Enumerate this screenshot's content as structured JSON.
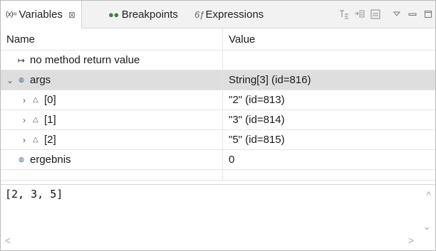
{
  "tabs": [
    {
      "icon_text": "(x)=",
      "label": "Variables",
      "close": "⊠"
    },
    {
      "icon_text": "●●",
      "label": "Breakpoints"
    },
    {
      "icon_text": "6ƒ",
      "label": "Expressions"
    }
  ],
  "toolbar": {
    "icons": [
      "show-type-names-icon",
      "collapse-all-icon",
      "layout-icon",
      "view-menu-icon",
      "minimize-icon",
      "maximize-icon"
    ]
  },
  "table": {
    "headers": {
      "name": "Name",
      "value": "Value"
    },
    "rows": [
      {
        "expander": "",
        "icon": "↦",
        "name": "no method return value",
        "value": ""
      },
      {
        "expander": "⌄",
        "icon": "◍",
        "name": "args",
        "value": "String[3]  (id=816)"
      },
      {
        "expander": "›",
        "icon": "△",
        "name": "[0]",
        "value": "\"2\" (id=813)"
      },
      {
        "expander": "›",
        "icon": "△",
        "name": "[1]",
        "value": "\"3\" (id=814)"
      },
      {
        "expander": "›",
        "icon": "△",
        "name": "[2]",
        "value": "\"5\" (id=815)"
      },
      {
        "expander": "",
        "icon": "◍",
        "name": "ergebnis",
        "value": "0"
      },
      {
        "expander": "",
        "icon": "",
        "name": "",
        "value": ""
      }
    ]
  },
  "detail": {
    "text": "[2, 3, 5]",
    "scroll_up": "^",
    "scroll_down": "⌄",
    "scroll_left": "<",
    "scroll_right": ">"
  },
  "colors": {
    "selected_row": "#dedede",
    "tabbar_bg": "#f2f2f2",
    "local_var_icon": "#3a6e8f"
  }
}
